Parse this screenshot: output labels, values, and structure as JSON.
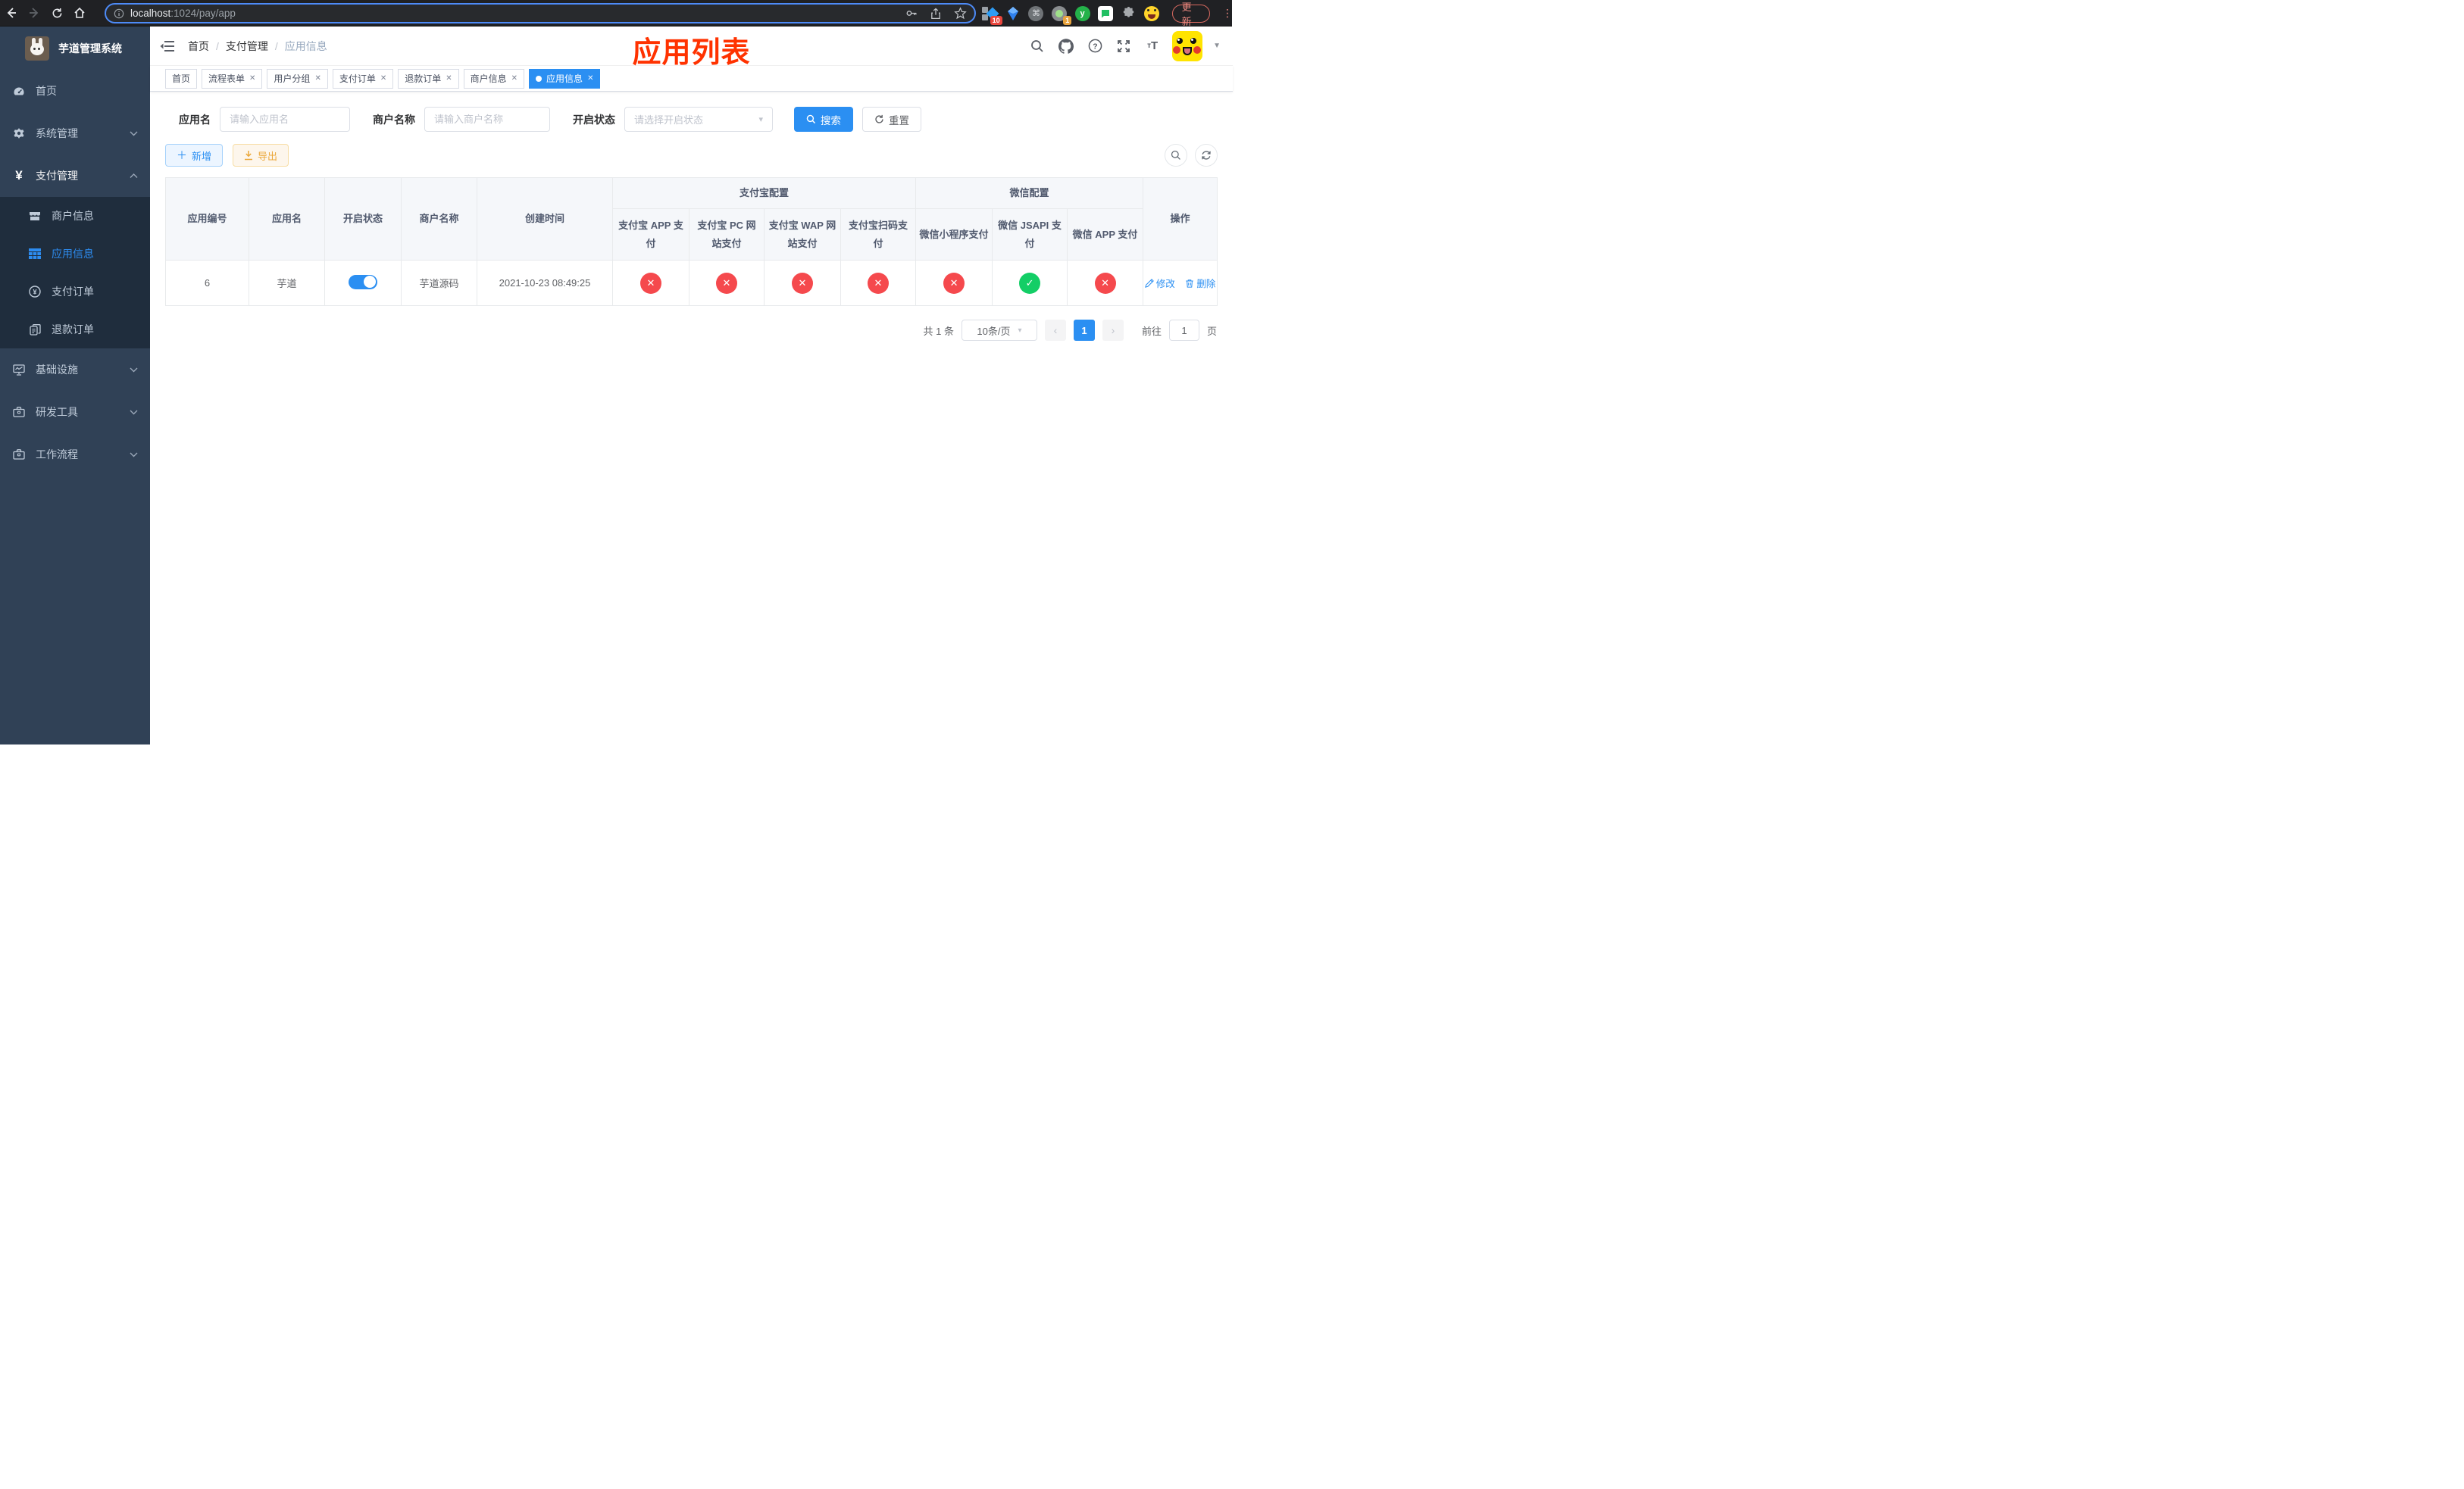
{
  "colors": {
    "accent": "#2b8ff2",
    "danger": "#f5494d",
    "success": "#13ce66",
    "annotation": "#ff3200"
  },
  "browser": {
    "url_host": "localhost",
    "url_path": ":1024/pay/app",
    "update_button": "更新",
    "ext_badge_blocker": "10",
    "ext_badge_recorder": "1",
    "ext_letter": "y"
  },
  "sidebar": {
    "title": "芋道管理系统",
    "menu": [
      {
        "label": "首页"
      },
      {
        "label": "系统管理"
      },
      {
        "label": "支付管理"
      },
      {
        "label": "基础设施"
      },
      {
        "label": "研发工具"
      },
      {
        "label": "工作流程"
      }
    ],
    "submenu": [
      {
        "label": "商户信息"
      },
      {
        "label": "应用信息"
      },
      {
        "label": "支付订单"
      },
      {
        "label": "退款订单"
      }
    ]
  },
  "navbar": {
    "breadcrumb": [
      "首页",
      "支付管理",
      "应用信息"
    ],
    "annotation": "应用列表"
  },
  "tabs": [
    {
      "label": "首页"
    },
    {
      "label": "流程表单"
    },
    {
      "label": "用户分组"
    },
    {
      "label": "支付订单"
    },
    {
      "label": "退款订单"
    },
    {
      "label": "商户信息"
    },
    {
      "label": "应用信息"
    }
  ],
  "filters": {
    "app_name_label": "应用名",
    "app_name_placeholder": "请输入应用名",
    "merchant_label": "商户名称",
    "merchant_placeholder": "请输入商户名称",
    "status_label": "开启状态",
    "status_placeholder": "请选择开启状态",
    "search_button": "搜索",
    "reset_button": "重置"
  },
  "toolbar": {
    "add_button": "新增",
    "export_button": "导出"
  },
  "table": {
    "headers": {
      "app_id": "应用编号",
      "app_name": "应用名",
      "status": "开启状态",
      "merchant": "商户名称",
      "created": "创建时间",
      "alipay_group": "支付宝配置",
      "wechat_group": "微信配置",
      "alipay_app": "支付宝 APP 支付",
      "alipay_pc": "支付宝 PC 网站支付",
      "alipay_wap": "支付宝 WAP 网站支付",
      "alipay_qr": "支付宝扫码支付",
      "wx_mini": "微信小程序支付",
      "wx_jsapi": "微信 JSAPI 支付",
      "wx_app": "微信 APP 支付",
      "actions": "操作"
    },
    "rows": [
      {
        "app_id": "6",
        "app_name": "芋道",
        "status_on": true,
        "merchant": "芋道源码",
        "created": "2021-10-23 08:49:25",
        "channels": [
          false,
          false,
          false,
          false,
          false,
          true,
          false
        ],
        "edit_label": "修改",
        "delete_label": "删除"
      }
    ]
  },
  "pagination": {
    "total": "共 1 条",
    "page_size": "10条/页",
    "current_page": "1",
    "goto_label": "前往",
    "goto_value": "1",
    "page_label": "页"
  }
}
